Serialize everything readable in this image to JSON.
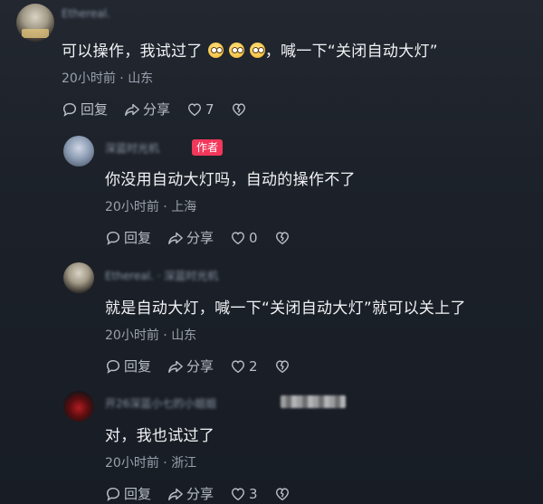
{
  "comments": [
    {
      "username": "Ethereal.",
      "text": "可以操作，我试过了",
      "text_after": "，喊一下“关闭自动大灯”",
      "time": "20小时前",
      "location": "山东",
      "reply_label": "回复",
      "share_label": "分享",
      "likes": "7"
    },
    {
      "username": "深蓝时光机",
      "badge": "作者",
      "text": "你没用自动大灯吗，自动的操作不了",
      "time": "20小时前",
      "location": "上海",
      "reply_label": "回复",
      "share_label": "分享",
      "likes": "0"
    },
    {
      "username": "Ethereal. · 深蓝时光机",
      "text": "就是自动大灯，喊一下“关闭自动大灯”就可以关上了",
      "time": "20小时前",
      "location": "山东",
      "reply_label": "回复",
      "share_label": "分享",
      "likes": "2"
    },
    {
      "username": "开26深蓝小七的小姐姐",
      "text": "对，我也试过了",
      "time": "20小时前",
      "location": "浙江",
      "reply_label": "回复",
      "share_label": "分享",
      "likes": "3"
    }
  ],
  "separator": "·",
  "icons": {
    "reply": "reply-bubble-icon",
    "share": "share-arrow-icon",
    "like": "heart-icon",
    "dislike": "broken-heart-icon"
  },
  "colors": {
    "background": "#1c2129",
    "text": "#f1f2f4",
    "meta": "#9aa1ad",
    "author_badge": "#f2385a"
  }
}
